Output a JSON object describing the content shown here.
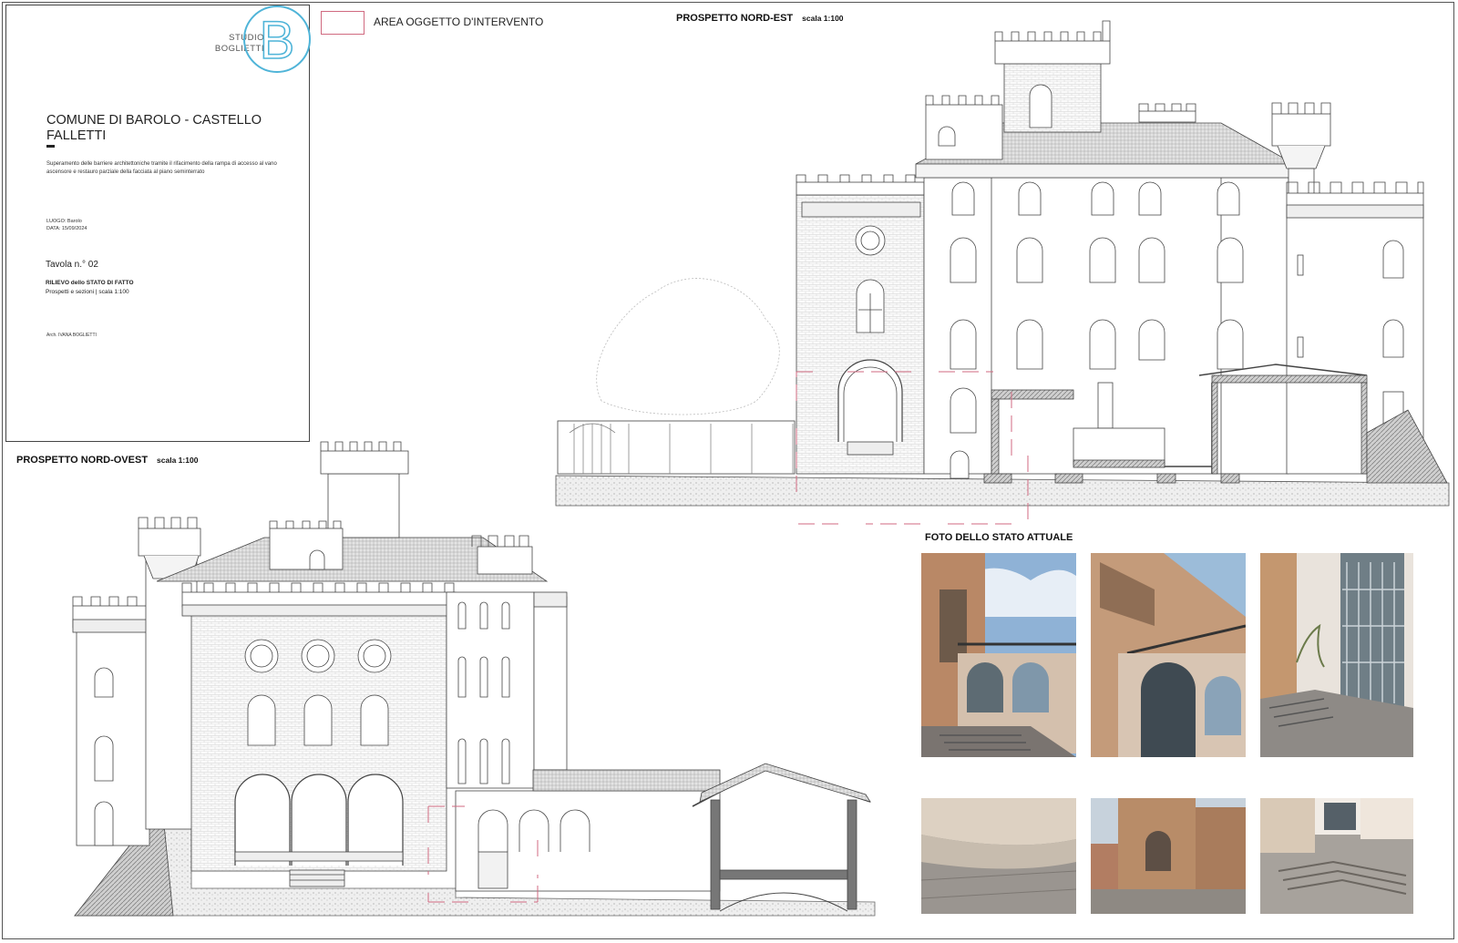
{
  "title_block": {
    "logo_line1": "STUDIO",
    "logo_line2": "BOGLIETTI",
    "logo_letter": "B",
    "project_title": "COMUNE DI BAROLO - CASTELLO FALLETTI",
    "description": "Superamento delle barriere architettoniche tramite il rifacimento della rampa di accesso al vano ascensore e restauro parziale della facciata al piano seminterrato",
    "luogo": "LUOGO: Barolo",
    "data": "DATA: 15/09/2024",
    "tavola": "Tavola n.° 02",
    "rilievo": "RILIEVO dello STATO DI FATTO",
    "prospetti": "Prospetti e sezioni | scala 1:100",
    "architect": "Arch. IVANA BOGLIETTI"
  },
  "legend": {
    "label": "AREA OGGETTO D'INTERVENTO",
    "color": "#d06a80"
  },
  "sections": {
    "nord_est": {
      "title": "PROSPETTO NORD-EST",
      "scale": "scala 1:100"
    },
    "nord_ovest": {
      "title": "PROSPETTO NORD-OVEST",
      "scale": "scala 1:100"
    },
    "foto": {
      "title": "FOTO DELLO STATO ATTUALE"
    }
  },
  "photos": [
    {
      "subject": "courtyard with ramp steps and arched windows"
    },
    {
      "subject": "arched entrance with balcony above"
    },
    {
      "subject": "glazed door and stone steps"
    },
    {
      "subject": "paved ramp and low wall"
    },
    {
      "subject": "tower facade view"
    },
    {
      "subject": "steps and cobbled courtyard"
    }
  ],
  "colors": {
    "line": "#444444",
    "hatch": "#9a9a9a",
    "intervention": "#d06a80",
    "logo": "#4fb4d8"
  }
}
